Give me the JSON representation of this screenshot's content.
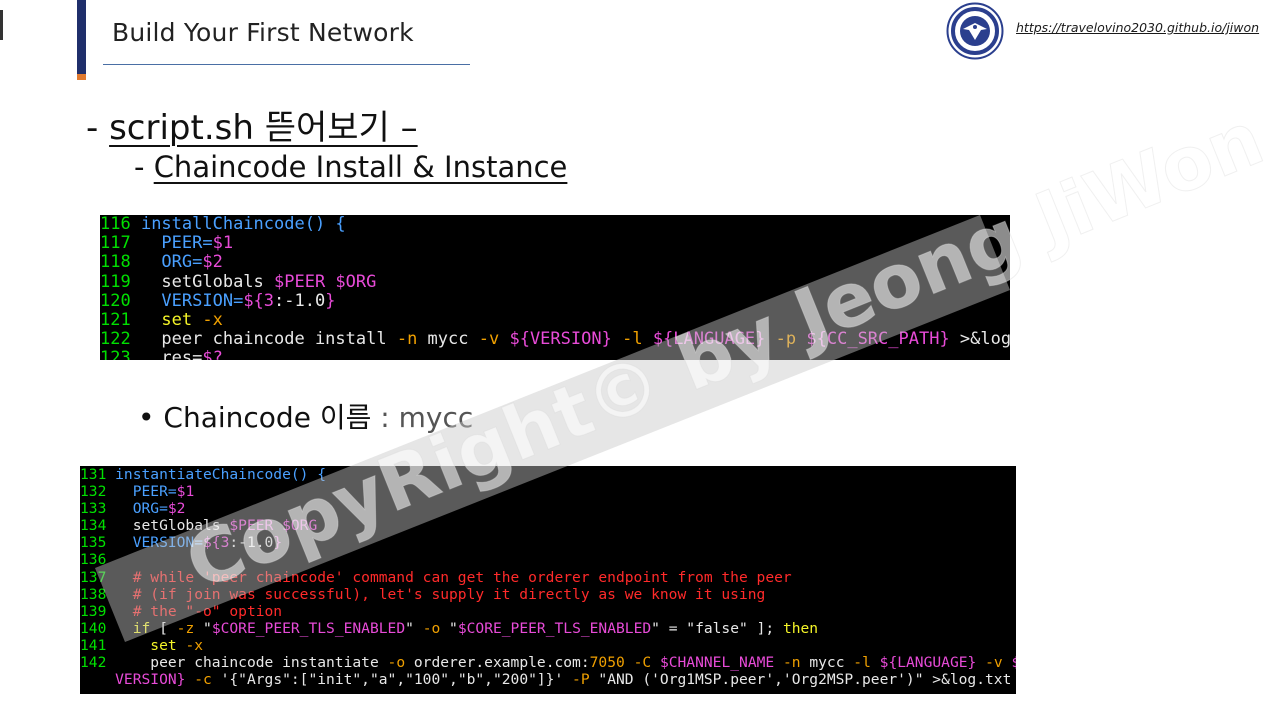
{
  "header": {
    "title": "Build Your First Network",
    "url": "https://travelovino2030.github.io/jiwon",
    "logo_icon": "university-seal-icon"
  },
  "heading1": {
    "prefix": "- ",
    "text": "script.sh 뜯어보기 –"
  },
  "heading2": {
    "prefix": "- ",
    "text": "Chaincode Install & Instance"
  },
  "bullet": {
    "label": "Chaincode 이름",
    "value": " : mycc"
  },
  "code1": [
    {
      "n": "116",
      "parts": [
        [
          "b",
          " installChaincode() {"
        ]
      ]
    },
    {
      "n": "117",
      "parts": [
        [
          "b",
          "   PEER="
        ],
        [
          "v",
          "$1"
        ]
      ]
    },
    {
      "n": "118",
      "parts": [
        [
          "b",
          "   ORG="
        ],
        [
          "v",
          "$2"
        ]
      ]
    },
    {
      "n": "119",
      "parts": [
        [
          "t",
          "   setGlobals "
        ],
        [
          "v",
          "$PEER $ORG"
        ]
      ]
    },
    {
      "n": "120",
      "parts": [
        [
          "b",
          "   VERSION="
        ],
        [
          "v",
          "${3"
        ],
        [
          "t",
          ":-1.0"
        ],
        [
          "v",
          "}"
        ]
      ]
    },
    {
      "n": "121",
      "parts": [
        [
          "y",
          "   set "
        ],
        [
          "o",
          "-x"
        ]
      ]
    },
    {
      "n": "122",
      "parts": [
        [
          "t",
          "   peer chaincode install "
        ],
        [
          "o",
          "-n"
        ],
        [
          "t",
          " mycc "
        ],
        [
          "o",
          "-v"
        ],
        [
          "t",
          " "
        ],
        [
          "v",
          "${VERSION}"
        ],
        [
          "t",
          " "
        ],
        [
          "o",
          "-l"
        ],
        [
          "t",
          " "
        ],
        [
          "v",
          "${LANGUAGE}"
        ],
        [
          "t",
          " "
        ],
        [
          "o",
          "-p"
        ],
        [
          "t",
          " "
        ],
        [
          "v",
          "${CC_SRC_PATH}"
        ],
        [
          "t",
          " >&log.txt"
        ]
      ]
    },
    {
      "n": "123",
      "parts": [
        [
          "t",
          "   res="
        ],
        [
          "v",
          "$?"
        ]
      ]
    }
  ],
  "code2": [
    {
      "n": "131",
      "parts": [
        [
          "b",
          " instantiateChaincode() {"
        ]
      ]
    },
    {
      "n": "132",
      "parts": [
        [
          "b",
          "   PEER="
        ],
        [
          "v",
          "$1"
        ]
      ]
    },
    {
      "n": "133",
      "parts": [
        [
          "b",
          "   ORG="
        ],
        [
          "v",
          "$2"
        ]
      ]
    },
    {
      "n": "134",
      "parts": [
        [
          "t",
          "   setGlobals "
        ],
        [
          "v",
          "$PEER $ORG"
        ]
      ]
    },
    {
      "n": "135",
      "parts": [
        [
          "b",
          "   VERSION="
        ],
        [
          "v",
          "${3"
        ],
        [
          "t",
          ":-1.0"
        ],
        [
          "v",
          "}"
        ]
      ]
    },
    {
      "n": "136",
      "parts": [
        [
          "t",
          ""
        ]
      ]
    },
    {
      "n": "137",
      "parts": [
        [
          "c",
          "   # while 'peer chaincode' command can get the orderer endpoint from the peer"
        ]
      ]
    },
    {
      "n": "138",
      "parts": [
        [
          "c",
          "   # (if join was successful), let's supply it directly as we know it using"
        ]
      ]
    },
    {
      "n": "139",
      "parts": [
        [
          "c",
          "   # the \"-o\" option"
        ]
      ]
    },
    {
      "n": "140",
      "parts": [
        [
          "y",
          "   if"
        ],
        [
          "t",
          " [ "
        ],
        [
          "o",
          "-z"
        ],
        [
          "t",
          " \""
        ],
        [
          "v",
          "$CORE_PEER_TLS_ENABLED"
        ],
        [
          "t",
          "\" "
        ],
        [
          "o",
          "-o"
        ],
        [
          "t",
          " \""
        ],
        [
          "v",
          "$CORE_PEER_TLS_ENABLED"
        ],
        [
          "t",
          "\" = \"false\" ]; "
        ],
        [
          "y",
          "then"
        ]
      ]
    },
    {
      "n": "141",
      "parts": [
        [
          "y",
          "     set "
        ],
        [
          "o",
          "-x"
        ]
      ]
    },
    {
      "n": "142",
      "parts": [
        [
          "t",
          "     peer chaincode instantiate "
        ],
        [
          "o",
          "-o"
        ],
        [
          "t",
          " orderer.example.com:"
        ],
        [
          "o",
          "7050"
        ],
        [
          "t",
          " "
        ],
        [
          "o",
          "-C"
        ],
        [
          "t",
          " "
        ],
        [
          "v",
          "$CHANNEL_NAME"
        ],
        [
          "t",
          " "
        ],
        [
          "o",
          "-n"
        ],
        [
          "t",
          " mycc "
        ],
        [
          "o",
          "-l"
        ],
        [
          "t",
          " "
        ],
        [
          "v",
          "${LANGUAGE}"
        ],
        [
          "t",
          " "
        ],
        [
          "o",
          "-v"
        ],
        [
          "t",
          " "
        ],
        [
          "v",
          "${"
        ]
      ]
    },
    {
      "n": "",
      "parts": [
        [
          "v",
          "    VERSION}"
        ],
        [
          "t",
          " "
        ],
        [
          "o",
          "-c"
        ],
        [
          "t",
          " '{\"Args\":[\"init\",\"a\",\"100\",\"b\",\"200\"]}' "
        ],
        [
          "o",
          "-P"
        ],
        [
          "t",
          " \"AND ('Org1MSP.peer','Org2MSP.peer')\" >&log.txt"
        ]
      ]
    }
  ],
  "watermark": "CopyRight© by Jeong JiWon",
  "colors": {
    "accent": "#1f2f6b",
    "accent_tip": "#e07a2f",
    "terminal_bg": "#000000"
  }
}
